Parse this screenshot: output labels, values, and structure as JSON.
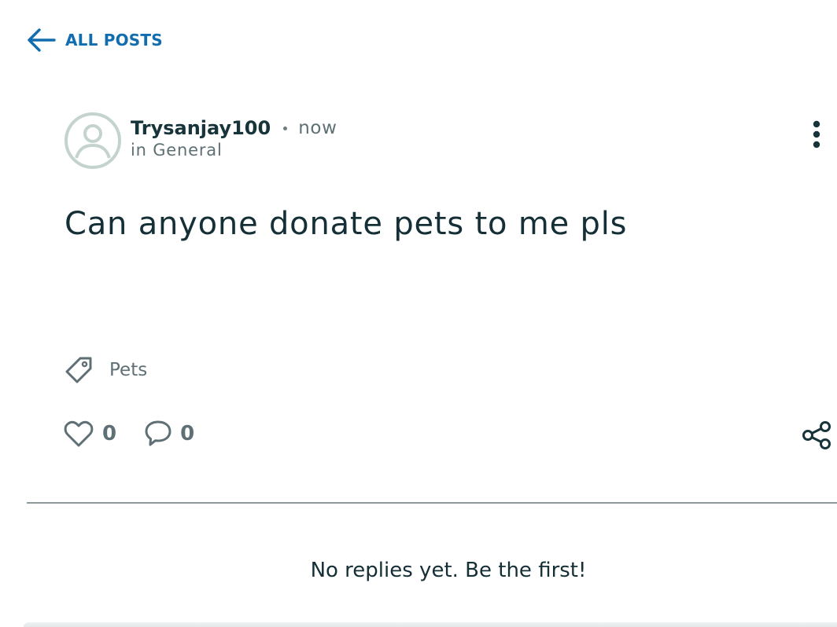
{
  "nav": {
    "back_label": "ALL POSTS",
    "back_icon": "arrow-left-icon"
  },
  "post": {
    "author": "Trysanjay100",
    "time": "now",
    "category": "in General",
    "title": "Can anyone donate pets to me pls",
    "tag": "Pets",
    "likes": "0",
    "comments": "0"
  },
  "replies": {
    "empty_message": "No replies yet. Be the first!"
  },
  "icons": {
    "avatar": "user-avatar-icon",
    "more": "more-vertical-icon",
    "tag": "tag-icon",
    "like": "heart-icon",
    "comment": "comment-icon",
    "share": "share-icon"
  },
  "colors": {
    "accent": "#116dae",
    "text_primary": "#142f36",
    "text_secondary": "#5e7075",
    "avatar": "#c5d3cf"
  }
}
